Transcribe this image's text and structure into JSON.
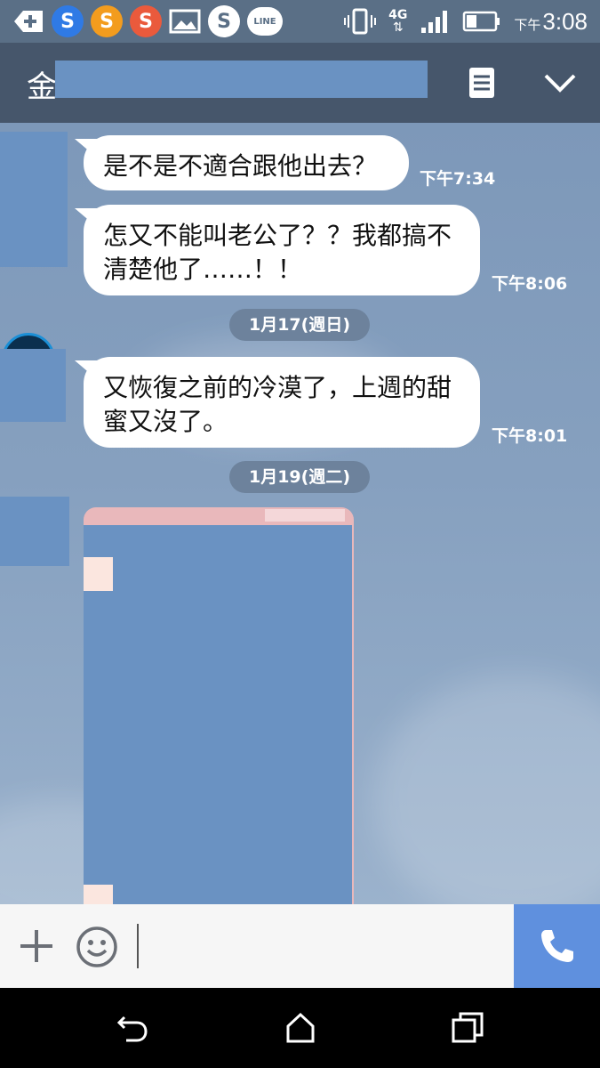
{
  "status_bar": {
    "time_prefix": "下午",
    "time": "3:08",
    "network": "4G",
    "line_badge": "LINE",
    "app_icons": [
      "plus-icon",
      "s-app-icon-blue",
      "s-app-icon-orange",
      "s-app-icon-red",
      "image-icon",
      "skype-icon",
      "line-icon"
    ]
  },
  "header": {
    "title": "金",
    "menu_icon": "note-icon",
    "collapse_icon": "chevron-down-icon"
  },
  "chat": {
    "messages": [
      {
        "text": "是不是不適合跟他出去？",
        "time": "下午7:34"
      },
      {
        "text": "怎又不能叫老公了？？我都搞不清楚他了……！！",
        "time": "下午8:06"
      },
      {
        "text": "又恢復之前的冷漠了，上週的甜蜜又沒了。",
        "time": "下午8:01"
      }
    ],
    "dates": [
      "1月17(週日)",
      "1月19(週二)"
    ]
  },
  "input_bar": {
    "add_icon": "plus-icon",
    "emoji_icon": "smiley-icon",
    "call_icon": "phone-icon"
  },
  "colors": {
    "header": "#46566b",
    "status": "#5a6f86",
    "call_button": "#5f90de",
    "redaction": "#6a92c2"
  }
}
